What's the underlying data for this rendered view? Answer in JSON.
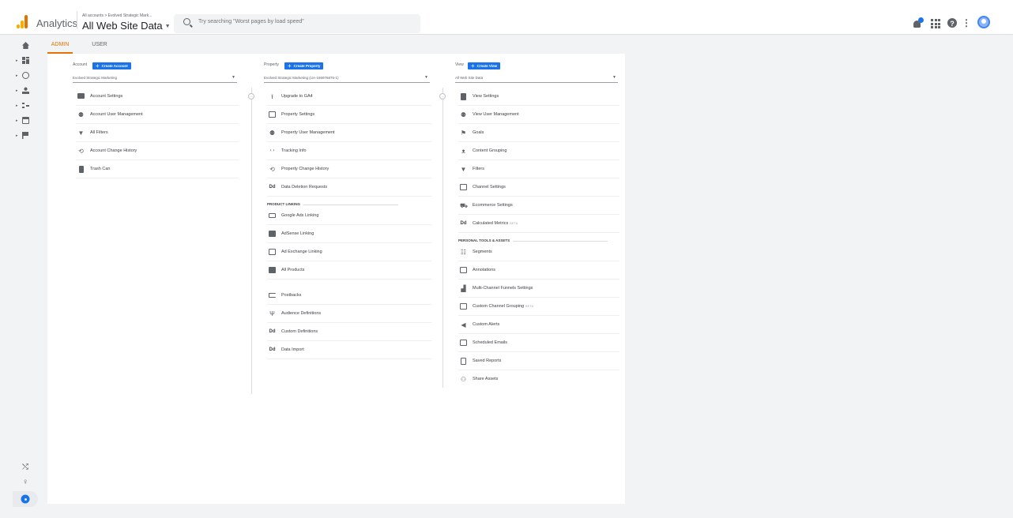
{
  "header": {
    "app_name": "Analytics",
    "breadcrumb": "All accounts > Evolved Strategic Mark...",
    "view_name": "All Web Site Data",
    "search_placeholder": "Try searching \"Worst pages by load speed\"",
    "brand_colors": {
      "logo_bar1": "#f9ab00",
      "logo_bar2": "#f9ab00",
      "logo_bar3": "#e37400",
      "accent": "#1a73e8",
      "active_tab": "#e37400"
    },
    "icons": [
      "notifications-icon",
      "apps-icon",
      "help-icon",
      "more-vert-icon",
      "account-avatar"
    ]
  },
  "sidebar": {
    "items": [
      "home-icon",
      "customization-icon",
      "realtime-icon",
      "audience-icon",
      "acquisition-icon",
      "behavior-icon",
      "conversions-icon"
    ],
    "bottom": [
      "attribution-icon",
      "discover-icon",
      "admin-gear-icon"
    ]
  },
  "tabs": [
    {
      "label": "ADMIN",
      "active": true
    },
    {
      "label": "USER",
      "active": false
    }
  ],
  "account": {
    "heading": "Account",
    "create_label": "Create Account",
    "selected": "Evolved Strategic Marketing",
    "items": [
      {
        "label": "Account Settings",
        "icon": "building-icon"
      },
      {
        "label": "Account User Management",
        "icon": "people-icon"
      },
      {
        "label": "All Filters",
        "icon": "filter-icon"
      },
      {
        "label": "Account Change History",
        "icon": "history-icon"
      },
      {
        "label": "Trash Can",
        "icon": "trash-icon"
      }
    ]
  },
  "property": {
    "heading": "Property",
    "create_label": "Create Property",
    "selected": "Evolved Strategic Marketing (UA-166976876-1)",
    "items": [
      {
        "label": "Upgrade to GA4",
        "icon": "upload-icon"
      },
      {
        "label": "Property Settings",
        "icon": "settings-box-icon"
      },
      {
        "label": "Property User Management",
        "icon": "people-icon"
      },
      {
        "label": "Tracking Info",
        "icon": "code-icon"
      },
      {
        "label": "Property Change History",
        "icon": "history-icon"
      },
      {
        "label": "Data Deletion Requests",
        "icon": "dd-icon"
      }
    ],
    "section_label": "PRODUCT LINKING",
    "linking": [
      {
        "label": "Google Ads Linking",
        "icon": "ads-icon"
      },
      {
        "label": "AdSense Linking",
        "icon": "adsense-icon"
      },
      {
        "label": "Ad Exchange Linking",
        "icon": "adx-icon"
      },
      {
        "label": "All Products",
        "icon": "products-icon"
      }
    ],
    "more": [
      {
        "label": "Postbacks",
        "icon": "postback-icon"
      },
      {
        "label": "Audience Definitions",
        "icon": "audience-fork-icon"
      },
      {
        "label": "Custom Definitions",
        "icon": "dd-icon"
      },
      {
        "label": "Data Import",
        "icon": "dd-icon"
      }
    ]
  },
  "view": {
    "heading": "View",
    "create_label": "Create View",
    "selected": "All Web Site Data",
    "items": [
      {
        "label": "View Settings",
        "icon": "doc-icon"
      },
      {
        "label": "View User Management",
        "icon": "people-icon"
      },
      {
        "label": "Goals",
        "icon": "flag-icon"
      },
      {
        "label": "Content Grouping",
        "icon": "person-walk-icon"
      },
      {
        "label": "Filters",
        "icon": "filter-icon"
      },
      {
        "label": "Channel Settings",
        "icon": "channel-icon"
      },
      {
        "label": "Ecommerce Settings",
        "icon": "cart-icon"
      },
      {
        "label": "Calculated Metrics",
        "icon": "dd-icon",
        "badge": "BETA"
      }
    ],
    "section_label": "PERSONAL TOOLS & ASSETS",
    "tools": [
      {
        "label": "Segments",
        "icon": "segments-icon"
      },
      {
        "label": "Annotations",
        "icon": "annotation-icon"
      },
      {
        "label": "Multi-Channel Funnels Settings",
        "icon": "bars-icon"
      },
      {
        "label": "Custom Channel Grouping",
        "icon": "channel-icon",
        "badge": "BETA"
      },
      {
        "label": "Custom Alerts",
        "icon": "megaphone-icon"
      },
      {
        "label": "Scheduled Emails",
        "icon": "clock-box-icon"
      },
      {
        "label": "Saved Reports",
        "icon": "file-icon"
      },
      {
        "label": "Share Assets",
        "icon": "share-person-icon"
      }
    ]
  },
  "glyphs": {
    "caret": "▼",
    "plus": "+",
    "arrow": "▸",
    "upload": "⭱",
    "code": "‹ ›",
    "history": "⟲",
    "dd": "Dd",
    "cart": "🛒",
    "walk": "⚲",
    "expand": "→",
    "search_nav": "⚲",
    "attribution": "⤭"
  }
}
